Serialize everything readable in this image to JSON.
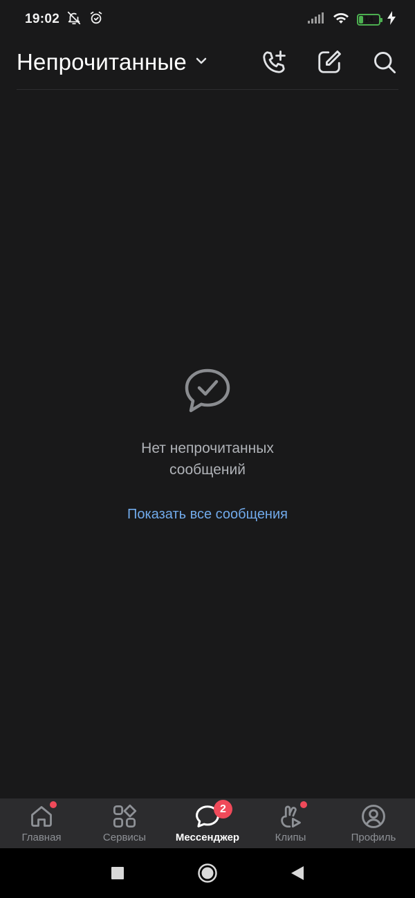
{
  "status_bar": {
    "time": "19:02",
    "battery_level": "14",
    "icons": [
      "mute-bell-icon",
      "alarm-icon",
      "signal-icon",
      "wifi-icon",
      "battery-icon",
      "charging-icon"
    ]
  },
  "header": {
    "title": "Непрочитанные",
    "actions": [
      "add-call-icon",
      "compose-icon",
      "search-icon"
    ]
  },
  "empty_state": {
    "icon": "message-check-icon",
    "text": "Нет непрочитанных сообщений",
    "link": "Показать все сообщения"
  },
  "tabs": [
    {
      "label": "Главная",
      "icon": "home-icon",
      "dot": true
    },
    {
      "label": "Сервисы",
      "icon": "services-icon",
      "dot": false
    },
    {
      "label": "Мессенджер",
      "icon": "messenger-icon",
      "badge": "2",
      "active": true
    },
    {
      "label": "Клипы",
      "icon": "clips-icon",
      "dot": true
    },
    {
      "label": "Профиль",
      "icon": "profile-icon",
      "dot": false
    }
  ],
  "nav_bar": [
    "recents-button",
    "home-button",
    "back-button"
  ],
  "colors": {
    "background": "#19191a",
    "tab_bar": "#2c2c2e",
    "accent_link": "#71aaeb",
    "badge": "#f04a5a",
    "battery": "#4caf50"
  }
}
